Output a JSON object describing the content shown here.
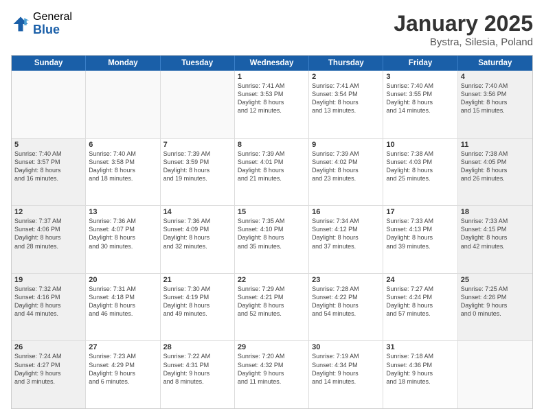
{
  "header": {
    "logo_general": "General",
    "logo_blue": "Blue",
    "month": "January 2025",
    "location": "Bystra, Silesia, Poland"
  },
  "days_of_week": [
    "Sunday",
    "Monday",
    "Tuesday",
    "Wednesday",
    "Thursday",
    "Friday",
    "Saturday"
  ],
  "rows": [
    [
      {
        "day": "",
        "info": "",
        "shaded": false,
        "empty": true
      },
      {
        "day": "",
        "info": "",
        "shaded": false,
        "empty": true
      },
      {
        "day": "",
        "info": "",
        "shaded": false,
        "empty": true
      },
      {
        "day": "1",
        "info": "Sunrise: 7:41 AM\nSunset: 3:53 PM\nDaylight: 8 hours\nand 12 minutes.",
        "shaded": false,
        "empty": false
      },
      {
        "day": "2",
        "info": "Sunrise: 7:41 AM\nSunset: 3:54 PM\nDaylight: 8 hours\nand 13 minutes.",
        "shaded": false,
        "empty": false
      },
      {
        "day": "3",
        "info": "Sunrise: 7:40 AM\nSunset: 3:55 PM\nDaylight: 8 hours\nand 14 minutes.",
        "shaded": false,
        "empty": false
      },
      {
        "day": "4",
        "info": "Sunrise: 7:40 AM\nSunset: 3:56 PM\nDaylight: 8 hours\nand 15 minutes.",
        "shaded": true,
        "empty": false
      }
    ],
    [
      {
        "day": "5",
        "info": "Sunrise: 7:40 AM\nSunset: 3:57 PM\nDaylight: 8 hours\nand 16 minutes.",
        "shaded": true,
        "empty": false
      },
      {
        "day": "6",
        "info": "Sunrise: 7:40 AM\nSunset: 3:58 PM\nDaylight: 8 hours\nand 18 minutes.",
        "shaded": false,
        "empty": false
      },
      {
        "day": "7",
        "info": "Sunrise: 7:39 AM\nSunset: 3:59 PM\nDaylight: 8 hours\nand 19 minutes.",
        "shaded": false,
        "empty": false
      },
      {
        "day": "8",
        "info": "Sunrise: 7:39 AM\nSunset: 4:01 PM\nDaylight: 8 hours\nand 21 minutes.",
        "shaded": false,
        "empty": false
      },
      {
        "day": "9",
        "info": "Sunrise: 7:39 AM\nSunset: 4:02 PM\nDaylight: 8 hours\nand 23 minutes.",
        "shaded": false,
        "empty": false
      },
      {
        "day": "10",
        "info": "Sunrise: 7:38 AM\nSunset: 4:03 PM\nDaylight: 8 hours\nand 25 minutes.",
        "shaded": false,
        "empty": false
      },
      {
        "day": "11",
        "info": "Sunrise: 7:38 AM\nSunset: 4:05 PM\nDaylight: 8 hours\nand 26 minutes.",
        "shaded": true,
        "empty": false
      }
    ],
    [
      {
        "day": "12",
        "info": "Sunrise: 7:37 AM\nSunset: 4:06 PM\nDaylight: 8 hours\nand 28 minutes.",
        "shaded": true,
        "empty": false
      },
      {
        "day": "13",
        "info": "Sunrise: 7:36 AM\nSunset: 4:07 PM\nDaylight: 8 hours\nand 30 minutes.",
        "shaded": false,
        "empty": false
      },
      {
        "day": "14",
        "info": "Sunrise: 7:36 AM\nSunset: 4:09 PM\nDaylight: 8 hours\nand 32 minutes.",
        "shaded": false,
        "empty": false
      },
      {
        "day": "15",
        "info": "Sunrise: 7:35 AM\nSunset: 4:10 PM\nDaylight: 8 hours\nand 35 minutes.",
        "shaded": false,
        "empty": false
      },
      {
        "day": "16",
        "info": "Sunrise: 7:34 AM\nSunset: 4:12 PM\nDaylight: 8 hours\nand 37 minutes.",
        "shaded": false,
        "empty": false
      },
      {
        "day": "17",
        "info": "Sunrise: 7:33 AM\nSunset: 4:13 PM\nDaylight: 8 hours\nand 39 minutes.",
        "shaded": false,
        "empty": false
      },
      {
        "day": "18",
        "info": "Sunrise: 7:33 AM\nSunset: 4:15 PM\nDaylight: 8 hours\nand 42 minutes.",
        "shaded": true,
        "empty": false
      }
    ],
    [
      {
        "day": "19",
        "info": "Sunrise: 7:32 AM\nSunset: 4:16 PM\nDaylight: 8 hours\nand 44 minutes.",
        "shaded": true,
        "empty": false
      },
      {
        "day": "20",
        "info": "Sunrise: 7:31 AM\nSunset: 4:18 PM\nDaylight: 8 hours\nand 46 minutes.",
        "shaded": false,
        "empty": false
      },
      {
        "day": "21",
        "info": "Sunrise: 7:30 AM\nSunset: 4:19 PM\nDaylight: 8 hours\nand 49 minutes.",
        "shaded": false,
        "empty": false
      },
      {
        "day": "22",
        "info": "Sunrise: 7:29 AM\nSunset: 4:21 PM\nDaylight: 8 hours\nand 52 minutes.",
        "shaded": false,
        "empty": false
      },
      {
        "day": "23",
        "info": "Sunrise: 7:28 AM\nSunset: 4:22 PM\nDaylight: 8 hours\nand 54 minutes.",
        "shaded": false,
        "empty": false
      },
      {
        "day": "24",
        "info": "Sunrise: 7:27 AM\nSunset: 4:24 PM\nDaylight: 8 hours\nand 57 minutes.",
        "shaded": false,
        "empty": false
      },
      {
        "day": "25",
        "info": "Sunrise: 7:25 AM\nSunset: 4:26 PM\nDaylight: 9 hours\nand 0 minutes.",
        "shaded": true,
        "empty": false
      }
    ],
    [
      {
        "day": "26",
        "info": "Sunrise: 7:24 AM\nSunset: 4:27 PM\nDaylight: 9 hours\nand 3 minutes.",
        "shaded": true,
        "empty": false
      },
      {
        "day": "27",
        "info": "Sunrise: 7:23 AM\nSunset: 4:29 PM\nDaylight: 9 hours\nand 6 minutes.",
        "shaded": false,
        "empty": false
      },
      {
        "day": "28",
        "info": "Sunrise: 7:22 AM\nSunset: 4:31 PM\nDaylight: 9 hours\nand 8 minutes.",
        "shaded": false,
        "empty": false
      },
      {
        "day": "29",
        "info": "Sunrise: 7:20 AM\nSunset: 4:32 PM\nDaylight: 9 hours\nand 11 minutes.",
        "shaded": false,
        "empty": false
      },
      {
        "day": "30",
        "info": "Sunrise: 7:19 AM\nSunset: 4:34 PM\nDaylight: 9 hours\nand 14 minutes.",
        "shaded": false,
        "empty": false
      },
      {
        "day": "31",
        "info": "Sunrise: 7:18 AM\nSunset: 4:36 PM\nDaylight: 9 hours\nand 18 minutes.",
        "shaded": false,
        "empty": false
      },
      {
        "day": "",
        "info": "",
        "shaded": true,
        "empty": true
      }
    ]
  ]
}
